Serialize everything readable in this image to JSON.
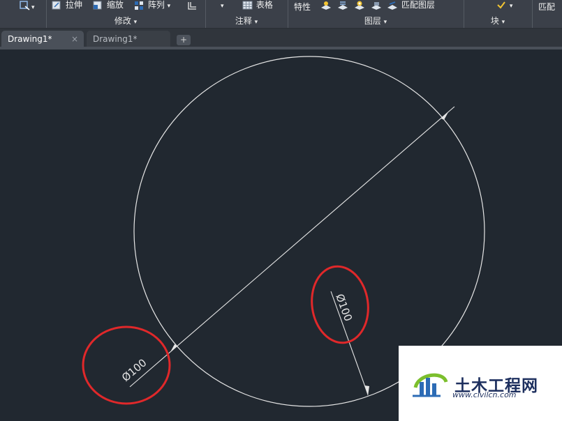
{
  "ribbon": {
    "modify": {
      "stretch_label": "拉伸",
      "scale_label": "缩放",
      "array_label": "阵列",
      "group_label": "修改"
    },
    "annotation": {
      "table_label": "表格",
      "group_label": "注释"
    },
    "layers": {
      "properties_label": "特性",
      "match_layer_label": "匹配图层",
      "group_label": "图层"
    },
    "block": {
      "group_label": "块"
    },
    "clipboard": {
      "match_label": "匹配"
    },
    "dropdown_caret": "▾"
  },
  "tabs": [
    {
      "label": "Drawing1*",
      "close": "×",
      "active": true
    },
    {
      "label": "Drawing1*",
      "active": false
    }
  ],
  "new_tab_label": "+",
  "drawing": {
    "dimension_left_text": "Ø100",
    "dimension_right_text": "Ø100",
    "line_color": "#e6e6e6",
    "highlight_color": "#e0282a"
  },
  "watermark": {
    "title": "土木工程网",
    "url": "www.civilcn.com"
  }
}
